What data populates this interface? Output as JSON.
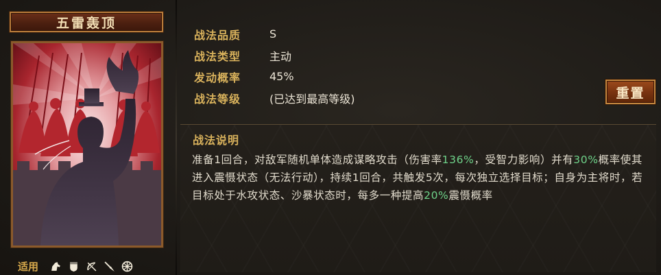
{
  "skill": {
    "name": "五雷轰顶"
  },
  "attributes": [
    {
      "label": "战法品质",
      "value": "S"
    },
    {
      "label": "战法类型",
      "value": "主动"
    },
    {
      "label": "发动概率",
      "value": "45%"
    },
    {
      "label": "战法等级",
      "value": "(已达到最高等级)"
    }
  ],
  "reset_label": "重置",
  "description": {
    "title": "战法说明",
    "segments": [
      {
        "text": "准备1回合，对敌军随机单体造成谋略攻击（伤害率",
        "highlight": false
      },
      {
        "text": "136%",
        "highlight": true
      },
      {
        "text": "，受智力影响）并有",
        "highlight": false
      },
      {
        "text": "30%",
        "highlight": true
      },
      {
        "text": "概率使其进入震慑状态（无法行动），持续1回合，共触发5次，每次独立选择目标；自身为主将时，若目标处于水攻状态、沙暴状态时，每多一种提高",
        "highlight": false
      },
      {
        "text": "20%",
        "highlight": true
      },
      {
        "text": "震慑概率",
        "highlight": false
      }
    ]
  },
  "suitable": {
    "label": "适用",
    "units": [
      "cavalry-icon",
      "shield-icon",
      "bow-icon",
      "spear-icon",
      "siege-wheel-icon"
    ]
  },
  "colors": {
    "label_gold": "#d9b25c",
    "highlight_green": "#6fd38a",
    "card_red": "#b3262e"
  }
}
